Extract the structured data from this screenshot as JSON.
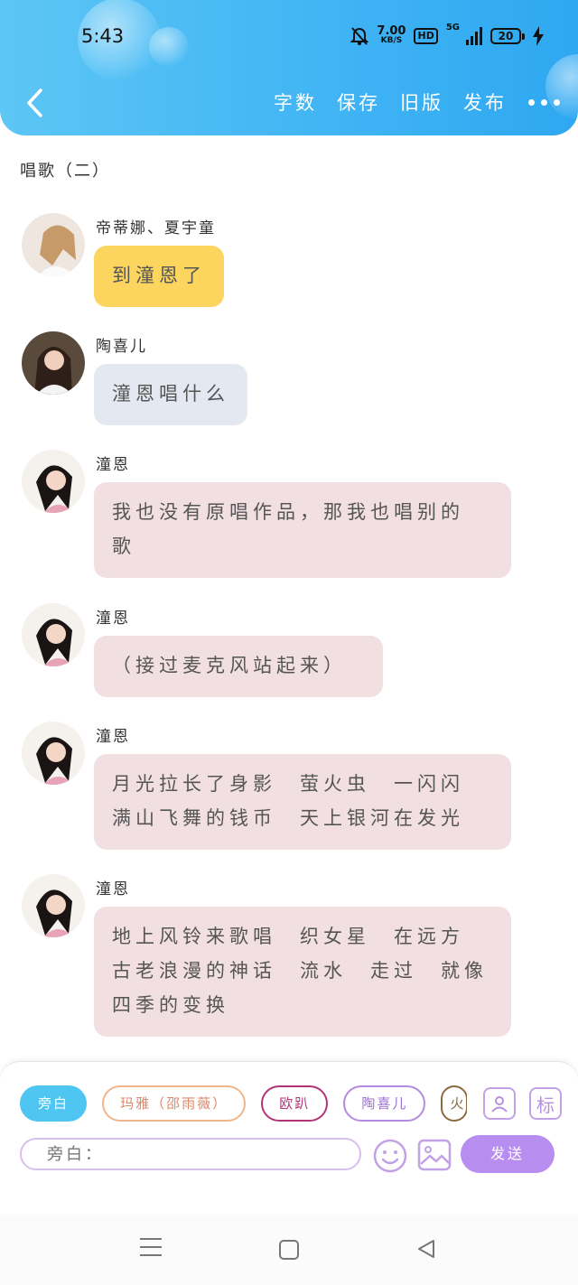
{
  "status_bar": {
    "time": "5:43",
    "net_speed": "7.00",
    "net_unit": "KB/S",
    "hd": "HD",
    "network": "5G",
    "battery": "20"
  },
  "toolbar": {
    "items": [
      "字数",
      "保存",
      "旧版",
      "发布"
    ]
  },
  "chapter_title": "唱歌（二）",
  "messages": [
    {
      "name": "帝蒂娜、夏宇童",
      "lines": [
        "到潼恩了"
      ],
      "color": "yellow"
    },
    {
      "name": "陶喜儿",
      "lines": [
        "潼恩唱什么"
      ],
      "color": "blue"
    },
    {
      "name": "潼恩",
      "lines": [
        "我也没有原唱作品，那我也唱别的",
        "歌"
      ],
      "color": "pink"
    },
    {
      "name": "潼恩",
      "lines": [
        "（接过麦克风站起来）"
      ],
      "color": "pink"
    },
    {
      "name": "潼恩",
      "lines": [
        "月光拉长了身影　萤火虫　一闪闪",
        "满山飞舞的钱币　天上银河在发光"
      ],
      "color": "pink"
    },
    {
      "name": "潼恩",
      "lines": [
        "地上风铃来歌唱　织女星　在远方",
        "古老浪漫的神话　流水　走过　就像",
        "四季的变换"
      ],
      "color": "pink"
    }
  ],
  "composer": {
    "chips": [
      "旁白",
      "玛雅（邵雨薇）",
      "欧趴",
      "陶喜儿",
      "火"
    ],
    "icon_button_label": "标",
    "input_placeholder": "旁白：",
    "send_label": "发送"
  },
  "colors": {
    "header_start": "#5cc6f5",
    "header_end": "#2fa8f1",
    "yellow_bubble": "#fcd55f",
    "blue_bubble": "#e4e8f0",
    "pink_bubble": "#f2dfe2",
    "send": "#b88df0"
  }
}
